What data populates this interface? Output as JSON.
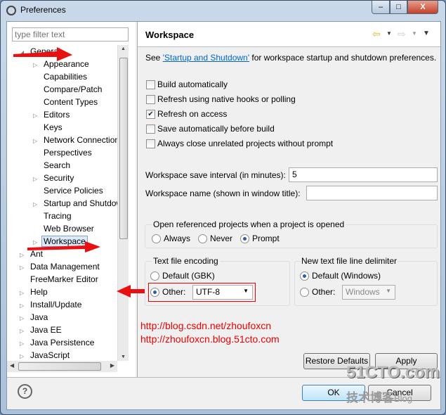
{
  "window": {
    "title": "Preferences",
    "controls": [
      "minimize",
      "maximize",
      "close"
    ]
  },
  "filter": {
    "placeholder": "type filter text"
  },
  "tree": [
    {
      "label": "General",
      "level": 1,
      "expanded": true
    },
    {
      "label": "Appearance",
      "level": 2,
      "expandable": true
    },
    {
      "label": "Capabilities",
      "level": 2
    },
    {
      "label": "Compare/Patch",
      "level": 2
    },
    {
      "label": "Content Types",
      "level": 2
    },
    {
      "label": "Editors",
      "level": 2,
      "expandable": true
    },
    {
      "label": "Keys",
      "level": 2
    },
    {
      "label": "Network Connections",
      "level": 2,
      "expandable": true
    },
    {
      "label": "Perspectives",
      "level": 2
    },
    {
      "label": "Search",
      "level": 2
    },
    {
      "label": "Security",
      "level": 2,
      "expandable": true
    },
    {
      "label": "Service Policies",
      "level": 2
    },
    {
      "label": "Startup and Shutdown",
      "level": 2,
      "expandable": true
    },
    {
      "label": "Tracing",
      "level": 2
    },
    {
      "label": "Web Browser",
      "level": 2
    },
    {
      "label": "Workspace",
      "level": 2,
      "expandable": true,
      "selected": true
    },
    {
      "label": "Ant",
      "level": 1,
      "expandable": true
    },
    {
      "label": "Data Management",
      "level": 1,
      "expandable": true
    },
    {
      "label": "FreeMarker Editor",
      "level": 1
    },
    {
      "label": "Help",
      "level": 1,
      "expandable": true
    },
    {
      "label": "Install/Update",
      "level": 1,
      "expandable": true
    },
    {
      "label": "Java",
      "level": 1,
      "expandable": true
    },
    {
      "label": "Java EE",
      "level": 1,
      "expandable": true
    },
    {
      "label": "Java Persistence",
      "level": 1,
      "expandable": true
    },
    {
      "label": "JavaScript",
      "level": 1,
      "expandable": true
    }
  ],
  "page": {
    "title": "Workspace",
    "intro_prefix": "See ",
    "intro_link": "'Startup and Shutdown'",
    "intro_suffix": " for workspace startup and shutdown preferences.",
    "checkboxes": [
      {
        "label": "Build automatically",
        "checked": false
      },
      {
        "label": "Refresh using native hooks or polling",
        "checked": false
      },
      {
        "label": "Refresh on access",
        "checked": true
      },
      {
        "label": "Save automatically before build",
        "checked": false
      },
      {
        "label": "Always close unrelated projects without prompt",
        "checked": false
      }
    ],
    "save_interval_label": "Workspace save interval (in minutes):",
    "save_interval_value": "5",
    "name_label": "Workspace name (shown in window title):",
    "name_value": "",
    "open_ref": {
      "label": "Open referenced projects when a project is opened",
      "options": [
        "Always",
        "Never",
        "Prompt"
      ],
      "selected": "Prompt"
    },
    "encoding": {
      "label": "Text file encoding",
      "default_label": "Default (GBK)",
      "other_label": "Other:",
      "other_value": "UTF-8",
      "selected": "Other"
    },
    "delimiter": {
      "label": "New text file line delimiter",
      "default_label": "Default (Windows)",
      "other_label": "Other:",
      "other_value": "Windows",
      "selected": "Default"
    },
    "restore_defaults": "Restore Defaults",
    "apply": "Apply"
  },
  "annotations": {
    "urls": [
      "http://blog.csdn.net/zhoufoxcn",
      "http://zhoufoxcn.blog.51cto.com"
    ],
    "color": "#ff0000"
  },
  "footer": {
    "ok": "OK",
    "cancel": "Cancel",
    "help_icon": "question-circle-icon"
  },
  "watermark": {
    "line1": "51CTO.com",
    "line2": "技术博客",
    "line3": "Blog"
  }
}
